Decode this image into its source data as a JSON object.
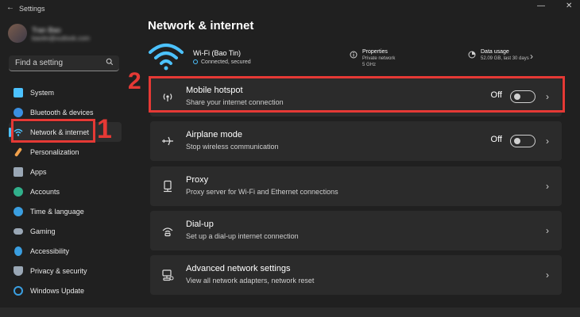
{
  "window": {
    "title": "Settings",
    "back_glyph": "←",
    "minimize_glyph": "—",
    "close_glyph": "✕"
  },
  "profile": {
    "name": "Tran Bao",
    "email": "baotin@outlook.com"
  },
  "search": {
    "placeholder": "Find a setting",
    "icon": "search-icon"
  },
  "sidebar": {
    "items": [
      {
        "label": "System",
        "icon": "system-icon",
        "color": "#4cc2ff"
      },
      {
        "label": "Bluetooth & devices",
        "icon": "bluetooth-icon",
        "color": "#3a8fe0"
      },
      {
        "label": "Network & internet",
        "icon": "wifi-icon",
        "color": "#4cc2ff",
        "active": true
      },
      {
        "label": "Personalization",
        "icon": "brush-icon",
        "color": "#f0a04b"
      },
      {
        "label": "Apps",
        "icon": "apps-icon",
        "color": "#9aa7b5"
      },
      {
        "label": "Accounts",
        "icon": "person-icon",
        "color": "#31b08b"
      },
      {
        "label": "Time & language",
        "icon": "globe-icon",
        "color": "#3a9ee0"
      },
      {
        "label": "Gaming",
        "icon": "controller-icon",
        "color": "#9aa7b5"
      },
      {
        "label": "Accessibility",
        "icon": "accessibility-icon",
        "color": "#3a9ee0"
      },
      {
        "label": "Privacy & security",
        "icon": "shield-icon",
        "color": "#9aa7b5"
      },
      {
        "label": "Windows Update",
        "icon": "update-icon",
        "color": "#3a9ee0"
      }
    ]
  },
  "annotations": {
    "step1": "1",
    "step2": "2",
    "color": "#e53935"
  },
  "main": {
    "title": "Network & internet",
    "wifi": {
      "name": "Wi-Fi (Bao Tin)",
      "status": "Connected, secured",
      "properties_title": "Properties",
      "properties_line1": "Private network",
      "properties_line2": "5 GHz",
      "data_usage_title": "Data usage",
      "data_usage_value": "52.09 GB, last 30 days"
    },
    "cards": [
      {
        "title": "Mobile hotspot",
        "subtitle": "Share your internet connection",
        "icon": "hotspot-icon",
        "toggle": "Off"
      },
      {
        "title": "Airplane mode",
        "subtitle": "Stop wireless communication",
        "icon": "airplane-icon",
        "toggle": "Off"
      },
      {
        "title": "Proxy",
        "subtitle": "Proxy server for Wi-Fi and Ethernet connections",
        "icon": "proxy-icon"
      },
      {
        "title": "Dial-up",
        "subtitle": "Set up a dial-up internet connection",
        "icon": "dialup-icon"
      },
      {
        "title": "Advanced network settings",
        "subtitle": "View all network adapters, network reset",
        "icon": "advanced-network-icon"
      }
    ],
    "chevron_glyph": "›",
    "accent": "#4cc2ff"
  }
}
